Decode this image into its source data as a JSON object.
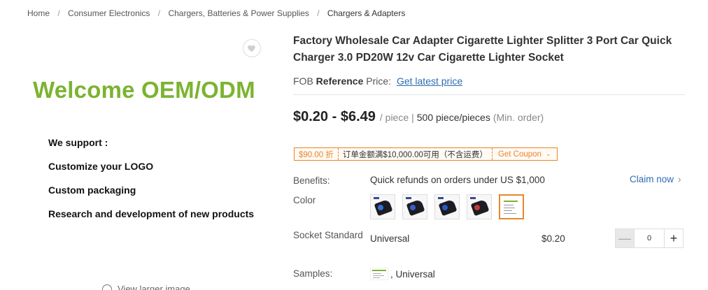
{
  "breadcrumb": {
    "items": [
      "Home",
      "Consumer Electronics",
      "Chargers, Batteries & Power Supplies",
      "Chargers & Adapters"
    ],
    "separator": "/"
  },
  "gallery": {
    "headline": "Welcome OEM/ODM",
    "support_lines": [
      "We support :",
      "Customize your LOGO",
      "Custom packaging",
      "Research and development of new products"
    ],
    "view_larger": "View larger image"
  },
  "product": {
    "title": "Factory Wholesale Car Adapter Cigarette Lighter Splitter 3 Port Car Quick Charger 3.0 PD20W 12v Car Cigarette Lighter Socket",
    "fob_prefix": "FOB",
    "fob_reference": "Reference",
    "fob_price_label": "Price:",
    "fob_link": "Get latest price",
    "price_range": "$0.20 - $6.49",
    "unit": "/ piece",
    "pipe": "|",
    "moq": "500 piece/pieces",
    "moq_note": "(Min. order)"
  },
  "coupon": {
    "amount": "$90.00 折",
    "condition": "订单金额满$10,000.00可用（不含运费）",
    "cta": "Get Coupon",
    "accent": "#e8862a"
  },
  "benefits": {
    "label": "Benefits:",
    "value": "Quick refunds on orders under US $1,000",
    "claim": "Claim now"
  },
  "color": {
    "label": "Color",
    "swatches": [
      {
        "name": "blue-led",
        "led": "#2f6fd8"
      },
      {
        "name": "blue-led-2",
        "led": "#3a5fd0"
      },
      {
        "name": "blue-led-3",
        "led": "#2a58c8"
      },
      {
        "name": "red-led",
        "led": "#c23b3b"
      },
      {
        "name": "sample-card",
        "selected": true
      }
    ]
  },
  "socket": {
    "label": "Socket Standard",
    "value": "Universal",
    "price": "$0.20",
    "quantity": "0",
    "minus": "—",
    "plus": "+"
  },
  "samples": {
    "label": "Samples:",
    "value": ", Universal"
  }
}
